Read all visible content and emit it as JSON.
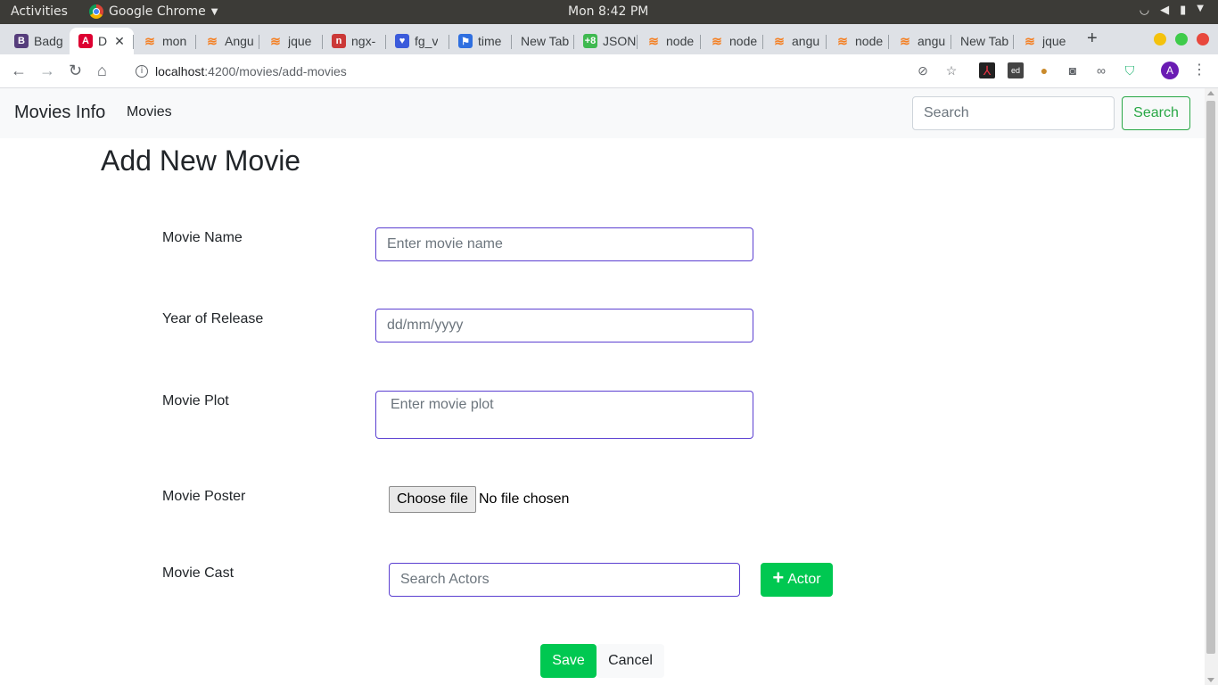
{
  "os_bar": {
    "activities": "Activities",
    "app_name": "Google Chrome",
    "clock": "Mon  8:42 PM"
  },
  "tabs": [
    {
      "title": "Badg",
      "icon": "bootstrap-icon",
      "color": "#563d7c",
      "glyph": "B"
    },
    {
      "title": "D",
      "icon": "angular-icon",
      "color": "#dd0031",
      "glyph": "A",
      "active": true
    },
    {
      "title": "mon",
      "icon": "stackoverflow-icon",
      "color": "#f48024",
      "glyph": "≋"
    },
    {
      "title": "Angu",
      "icon": "stackoverflow-icon",
      "color": "#f48024",
      "glyph": "≋"
    },
    {
      "title": "jque",
      "icon": "stackoverflow-icon",
      "color": "#f48024",
      "glyph": "≋"
    },
    {
      "title": "ngx-",
      "icon": "npm-icon",
      "color": "#cb3837",
      "glyph": "n"
    },
    {
      "title": "fg_v",
      "icon": "shield-icon",
      "color": "#3b5bdb",
      "glyph": "♥"
    },
    {
      "title": "time",
      "icon": "flag-icon",
      "color": "#2f6fe0",
      "glyph": "⚑"
    },
    {
      "title": "New Tab",
      "icon": "",
      "color": "",
      "glyph": ""
    },
    {
      "title": "JSON",
      "icon": "json-icon",
      "color": "#3fb950",
      "glyph": "+8"
    },
    {
      "title": "node",
      "icon": "stackoverflow-icon",
      "color": "#f48024",
      "glyph": "≋"
    },
    {
      "title": "node",
      "icon": "stackoverflow-icon",
      "color": "#f48024",
      "glyph": "≋"
    },
    {
      "title": "angu",
      "icon": "stackoverflow-icon",
      "color": "#f48024",
      "glyph": "≋"
    },
    {
      "title": "node",
      "icon": "stackoverflow-icon",
      "color": "#f48024",
      "glyph": "≋"
    },
    {
      "title": "angu",
      "icon": "stackoverflow-icon",
      "color": "#f48024",
      "glyph": "≋"
    },
    {
      "title": "New Tab",
      "icon": "",
      "color": "",
      "glyph": ""
    },
    {
      "title": "jque",
      "icon": "stackoverflow-icon",
      "color": "#f48024",
      "glyph": "≋"
    }
  ],
  "address_bar": {
    "host": "localhost",
    "path": ":4200/movies/add-movies"
  },
  "profile_initial": "A",
  "navbar": {
    "brand": "Movies Info",
    "link": "Movies",
    "search_placeholder": "Search",
    "search_button": "Search"
  },
  "form": {
    "title": "Add New Movie",
    "movie_name_label": "Movie Name",
    "movie_name_placeholder": "Enter movie name",
    "year_label": "Year of Release",
    "year_placeholder": "dd/mm/yyyy",
    "plot_label": "Movie Plot",
    "plot_placeholder": "Enter movie plot",
    "poster_label": "Movie Poster",
    "file_button": "Choose file",
    "file_status": "No file chosen",
    "cast_label": "Movie Cast",
    "cast_placeholder": "Search Actors",
    "actor_button": "Actor",
    "save_button": "Save",
    "cancel_button": "Cancel"
  },
  "colors": {
    "accent_green": "#00c851",
    "outline_green": "#28a745",
    "field_border": "#5b3fd1"
  }
}
